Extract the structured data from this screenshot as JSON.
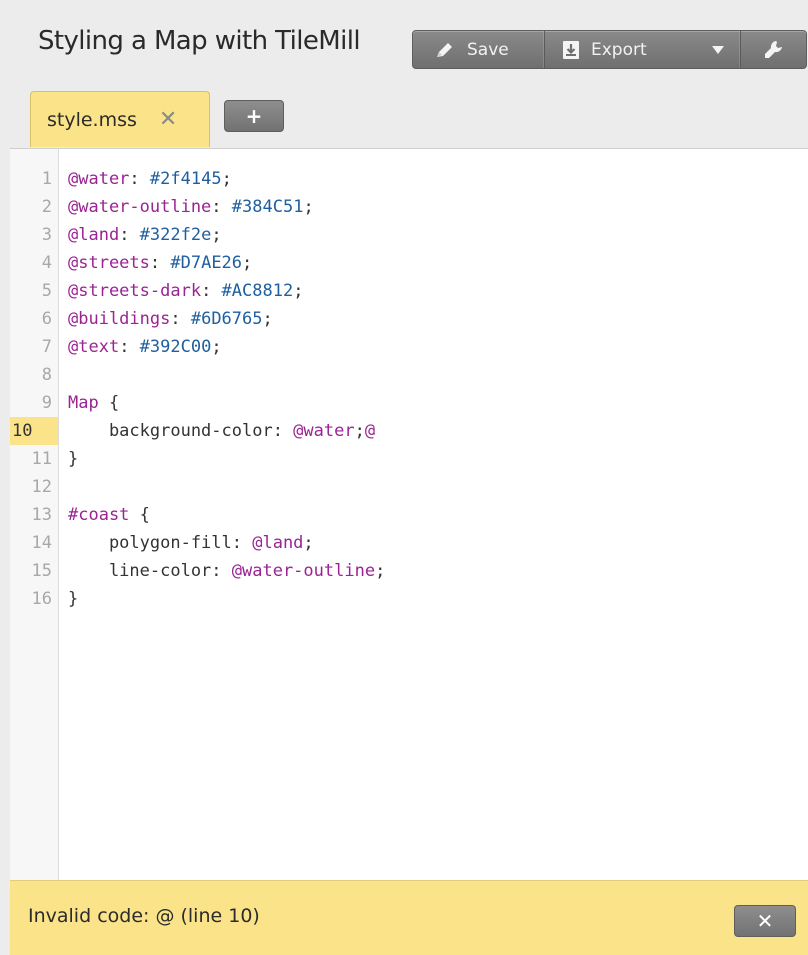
{
  "header": {
    "title": "Styling a Map with TileMill",
    "save_label": "Save",
    "export_label": "Export"
  },
  "tabs": [
    {
      "label": "style.mss",
      "close": "✕"
    }
  ],
  "add_tab_label": "+",
  "editor": {
    "active_line": 10,
    "lines": [
      {
        "n": "1",
        "tokens": [
          [
            "var",
            "@water"
          ],
          [
            "punc",
            ": "
          ],
          [
            "val",
            "#2f4145"
          ],
          [
            "punc",
            ";"
          ]
        ]
      },
      {
        "n": "2",
        "tokens": [
          [
            "var",
            "@water-outline"
          ],
          [
            "punc",
            ": "
          ],
          [
            "val",
            "#384C51"
          ],
          [
            "punc",
            ";"
          ]
        ]
      },
      {
        "n": "3",
        "tokens": [
          [
            "var",
            "@land"
          ],
          [
            "punc",
            ": "
          ],
          [
            "val",
            "#322f2e"
          ],
          [
            "punc",
            ";"
          ]
        ]
      },
      {
        "n": "4",
        "tokens": [
          [
            "var",
            "@streets"
          ],
          [
            "punc",
            ": "
          ],
          [
            "val",
            "#D7AE26"
          ],
          [
            "punc",
            ";"
          ]
        ]
      },
      {
        "n": "5",
        "tokens": [
          [
            "var",
            "@streets-dark"
          ],
          [
            "punc",
            ": "
          ],
          [
            "val",
            "#AC8812"
          ],
          [
            "punc",
            ";"
          ]
        ]
      },
      {
        "n": "6",
        "tokens": [
          [
            "var",
            "@buildings"
          ],
          [
            "punc",
            ": "
          ],
          [
            "val",
            "#6D6765"
          ],
          [
            "punc",
            ";"
          ]
        ]
      },
      {
        "n": "7",
        "tokens": [
          [
            "var",
            "@text"
          ],
          [
            "punc",
            ": "
          ],
          [
            "val",
            "#392C00"
          ],
          [
            "punc",
            ";"
          ]
        ]
      },
      {
        "n": "8",
        "tokens": []
      },
      {
        "n": "9",
        "tokens": [
          [
            "sel",
            "Map"
          ],
          [
            "punc",
            " {"
          ]
        ]
      },
      {
        "n": "10",
        "tokens": [
          [
            "punc",
            "    background-color: "
          ],
          [
            "var",
            "@water"
          ],
          [
            "punc",
            ";"
          ],
          [
            "var",
            "@"
          ]
        ]
      },
      {
        "n": "11",
        "tokens": [
          [
            "punc",
            "}"
          ]
        ]
      },
      {
        "n": "12",
        "tokens": []
      },
      {
        "n": "13",
        "tokens": [
          [
            "sel",
            "#coast"
          ],
          [
            "punc",
            " {"
          ]
        ]
      },
      {
        "n": "14",
        "tokens": [
          [
            "punc",
            "    polygon-fill: "
          ],
          [
            "var",
            "@land"
          ],
          [
            "punc",
            ";"
          ]
        ]
      },
      {
        "n": "15",
        "tokens": [
          [
            "punc",
            "    line-color: "
          ],
          [
            "var",
            "@water-outline"
          ],
          [
            "punc",
            ";"
          ]
        ]
      },
      {
        "n": "16",
        "tokens": [
          [
            "punc",
            "}"
          ]
        ]
      }
    ]
  },
  "status": {
    "message": "Invalid code: @ (line 10)",
    "close_label": "✕"
  },
  "colors": {
    "accent_yellow": "#fbe38a",
    "variable": "#9b2393",
    "value": "#1f5fa0",
    "button_gray": "#7f7f7f"
  },
  "icons": {
    "save": "pencil-icon",
    "export": "download-icon",
    "export_menu": "chevron-down-icon",
    "settings": "wrench-icon"
  }
}
